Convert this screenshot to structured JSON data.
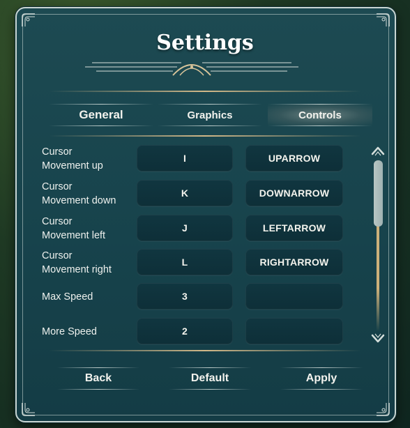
{
  "dialog": {
    "title": "Settings"
  },
  "tabs": [
    {
      "label": "General",
      "active": false
    },
    {
      "label": "Graphics",
      "active": false
    },
    {
      "label": "Controls",
      "active": true
    }
  ],
  "controls": [
    {
      "label_line1": "Cursor",
      "label_line2": "Movement up",
      "primary": "I",
      "secondary": "UPARROW"
    },
    {
      "label_line1": "Cursor",
      "label_line2": "Movement down",
      "primary": "K",
      "secondary": "DOWNARROW"
    },
    {
      "label_line1": "Cursor",
      "label_line2": "Movement left",
      "primary": "J",
      "secondary": "LEFTARROW"
    },
    {
      "label_line1": "Cursor",
      "label_line2": "Movement right",
      "primary": "L",
      "secondary": "RIGHTARROW"
    },
    {
      "label_line1": "Max Speed",
      "label_line2": "",
      "primary": "3",
      "secondary": ""
    },
    {
      "label_line1": "More Speed",
      "label_line2": "",
      "primary": "2",
      "secondary": ""
    }
  ],
  "footer": {
    "back_label": "Back",
    "default_label": "Default",
    "apply_label": "Apply"
  },
  "icons": {
    "scroll_up": "chevron-up-icon",
    "scroll_down": "chevron-down-icon",
    "ornament": "arch-ornament-icon",
    "corner": "corner-flourish-icon"
  },
  "colors": {
    "panel": "#1d4a52",
    "key_box": "#103640",
    "gold_rule": "#d2b888",
    "frame": "#c9d6d2"
  }
}
